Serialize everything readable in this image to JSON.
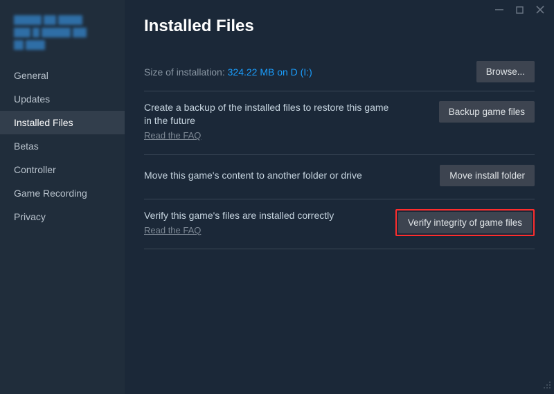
{
  "window": {
    "title": "Installed Files"
  },
  "sidebar": {
    "items": [
      {
        "label": "General"
      },
      {
        "label": "Updates"
      },
      {
        "label": "Installed Files"
      },
      {
        "label": "Betas"
      },
      {
        "label": "Controller"
      },
      {
        "label": "Game Recording"
      },
      {
        "label": "Privacy"
      }
    ],
    "active_index": 2
  },
  "main": {
    "title": "Installed Files",
    "size_label": "Size of installation: ",
    "size_value": "324.22 MB on D (I:)",
    "browse_label": "Browse...",
    "backup_desc": "Create a backup of the installed files to restore this game in the future",
    "faq_label": "Read the FAQ",
    "backup_btn": "Backup game files",
    "move_desc": "Move this game's content to another folder or drive",
    "move_btn": "Move install folder",
    "verify_desc": "Verify this game's files are installed correctly",
    "verify_btn": "Verify integrity of game files"
  }
}
